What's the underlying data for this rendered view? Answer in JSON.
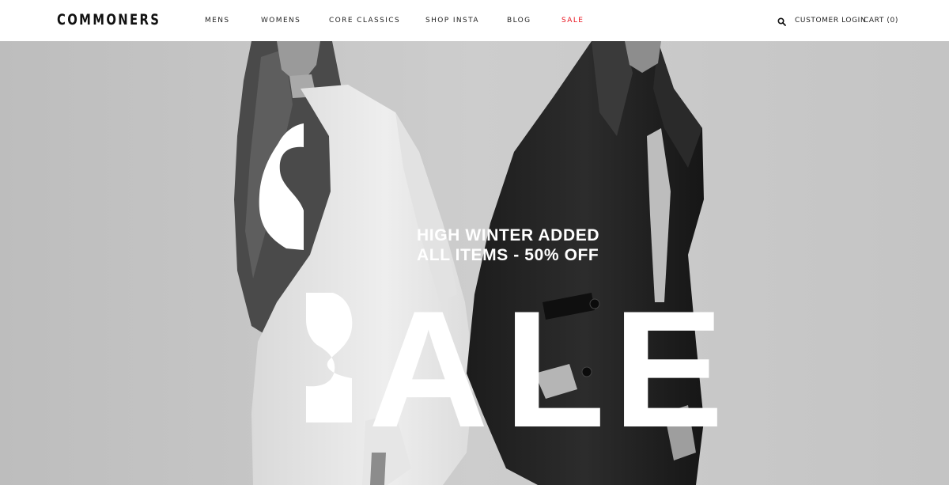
{
  "brand": {
    "logo": "COMMONERS"
  },
  "nav": {
    "items": [
      {
        "label": "MENS"
      },
      {
        "label": "WOMENS"
      },
      {
        "label": "CORE CLASSICS"
      },
      {
        "label": "SHOP INSTA"
      },
      {
        "label": "BLOG"
      },
      {
        "label": "SALE"
      }
    ]
  },
  "header_utils": {
    "search_icon": "magnifier",
    "login_label": "CUSTOMER LOGIN",
    "cart_label": "CART (0)"
  },
  "hero": {
    "promo_line_1": "HIGH WINTER ADDED",
    "promo_line_2": "ALL ITEMS - 50% OFF",
    "headline_letters": [
      "S",
      "A",
      "L",
      "E"
    ],
    "accent_color": "#e8111c"
  }
}
